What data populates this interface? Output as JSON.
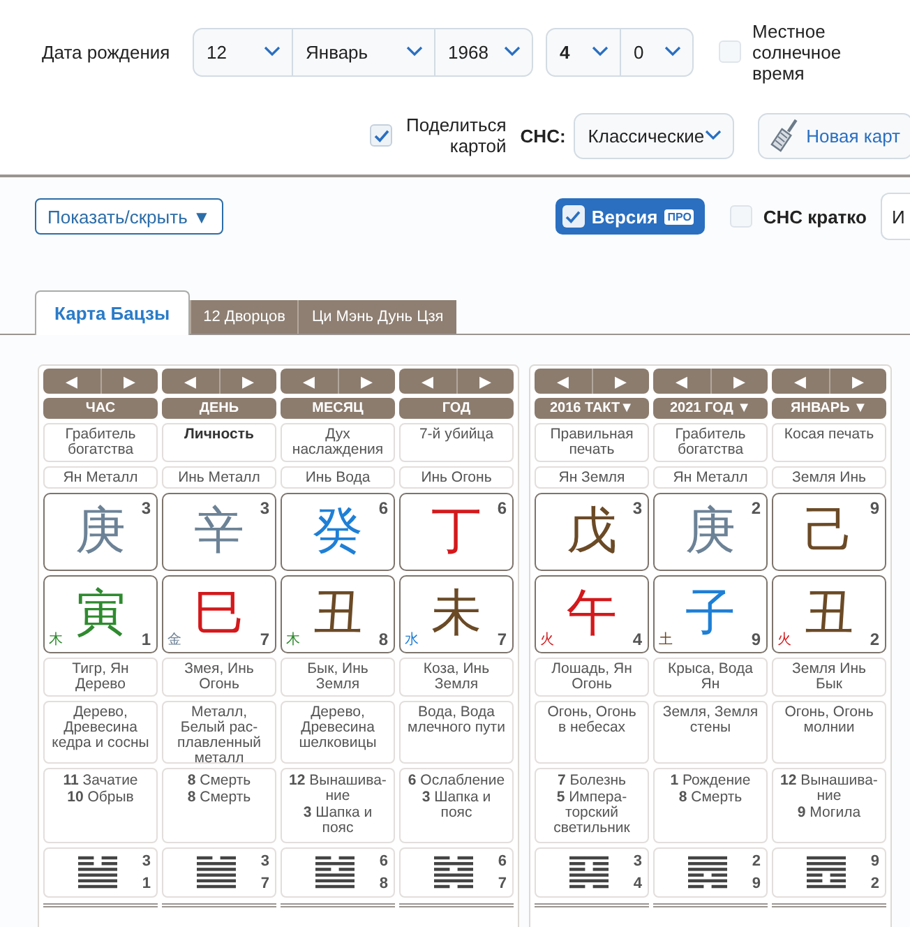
{
  "birth_date": {
    "label": "Дата рождения",
    "day": "12",
    "month": "Январь",
    "year": "1968",
    "hour": "4",
    "minute": "0"
  },
  "local_solar_time": {
    "label": "Местное солнечное время",
    "checked": false
  },
  "share_chart": {
    "label": "Поделиться картой",
    "checked": true
  },
  "sns": {
    "label": "СНС:",
    "value": "Классические"
  },
  "new_chart_button": "Новая карт",
  "show_hide_button": "Показать/скрыть ▼",
  "pro_version": {
    "label": "Версия",
    "badge": "ПРО",
    "checked": true
  },
  "sns_short": {
    "label": "СНС кратко",
    "checked": false
  },
  "cut_select": "И",
  "tabs": [
    {
      "label": "Карта Бацзы",
      "selected": true
    },
    {
      "label": "12 Дворцов",
      "selected": false
    },
    {
      "label": "Ци Мэнь Дунь Цзя",
      "selected": false
    }
  ],
  "charts": [
    {
      "pillars": [
        {
          "nav": [
            "◀",
            "▶"
          ],
          "header": "ЧАС",
          "ten_god": "Грабитель богатства",
          "self": false,
          "stem_element": "Ян Металл",
          "stem": {
            "char": "庚",
            "color": "#6c8296",
            "number": "3"
          },
          "branch": {
            "char": "寅",
            "color": "#2f8a2f",
            "number": "1",
            "element": {
              "char": "木",
              "color": "#2f8a2f"
            }
          },
          "animal": "Тигр, Ян Дерево",
          "nayin": "Дерево, Древесина кедра и сосны",
          "stages": [
            "**11** Зачатие",
            "**10** Обрыв"
          ],
          "hexagram": {
            "solid": [
              false,
              false,
              true,
              true,
              true,
              true
            ],
            "upper": "3",
            "lower": "1"
          }
        },
        {
          "nav": [
            "◀",
            "▶"
          ],
          "header": "ДЕНЬ",
          "ten_god": "Личность",
          "self": true,
          "stem_element": "Инь Металл",
          "stem": {
            "char": "辛",
            "color": "#6c8296",
            "number": "3"
          },
          "branch": {
            "char": "巳",
            "color": "#d3191c",
            "number": "7",
            "element": {
              "char": "金",
              "color": "#6c8296"
            }
          },
          "animal": "Змея, Инь Огонь",
          "nayin": "Металл, Белый рас-плавленный металл",
          "stages": [
            "**8** Смерть",
            "**8** Смерть"
          ],
          "hexagram": {
            "solid": [
              false,
              true,
              true,
              true,
              true,
              true
            ],
            "upper": "3",
            "lower": "7"
          }
        },
        {
          "nav": [
            "◀",
            "▶"
          ],
          "header": "МЕСЯЦ",
          "ten_god": "Дух наслаждения",
          "self": false,
          "stem_element": "Инь Вода",
          "stem": {
            "char": "癸",
            "color": "#1e7fd6",
            "number": "6"
          },
          "branch": {
            "char": "丑",
            "color": "#6b4a26",
            "number": "8",
            "element": {
              "char": "木",
              "color": "#2f8a2f"
            }
          },
          "animal": "Бык, Инь Земля",
          "nayin": "Дерево, Древесина шелковицы",
          "stages": [
            "**12** Вынашива-ние",
            "**3** Шапка и пояс"
          ],
          "hexagram": {
            "solid": [
              false,
              true,
              false,
              true,
              true,
              true
            ],
            "upper": "6",
            "lower": "8"
          }
        },
        {
          "nav": [
            "◀",
            "▶"
          ],
          "header": "ГОД",
          "ten_god": "7-й убийца",
          "self": false,
          "stem_element": "Инь Огонь",
          "stem": {
            "char": "丁",
            "color": "#d3191c",
            "number": "6"
          },
          "branch": {
            "char": "未",
            "color": "#6b4a26",
            "number": "7",
            "element": {
              "char": "水",
              "color": "#1e7fd6"
            }
          },
          "animal": "Коза, Инь Земля",
          "nayin": "Вода, Вода млечного пути",
          "stages": [
            "**6** Ослабление",
            "**3** Шапка и пояс"
          ],
          "hexagram": {
            "solid": [
              false,
              true,
              false,
              true,
              true,
              false
            ],
            "upper": "6",
            "lower": "7"
          }
        }
      ]
    },
    {
      "pillars": [
        {
          "nav": [
            "◀",
            "▶"
          ],
          "header": "2016 ТАКТ▼",
          "ten_god": "Правильная печать",
          "self": false,
          "stem_element": "Ян Земля",
          "stem": {
            "char": "戊",
            "color": "#6b4a26",
            "number": "3"
          },
          "branch": {
            "char": "午",
            "color": "#d3191c",
            "number": "4",
            "element": {
              "char": "火",
              "color": "#d3191c"
            }
          },
          "animal": "Лошадь, Ян Огонь",
          "nayin": "Огонь, Огонь в небесах",
          "stages": [
            "**7** Болезнь",
            "**5** Импера-торский светильник"
          ],
          "hexagram": {
            "solid": [
              true,
              false,
              false,
              true,
              true,
              false
            ],
            "upper": "3",
            "lower": "4"
          }
        },
        {
          "nav": [
            "◀",
            "▶"
          ],
          "header": "2021 ГОД ▼",
          "ten_god": "Грабитель богатства",
          "self": false,
          "stem_element": "Ян Металл",
          "stem": {
            "char": "庚",
            "color": "#6c8296",
            "number": "2"
          },
          "branch": {
            "char": "子",
            "color": "#1e7fd6",
            "number": "9",
            "element": {
              "char": "土",
              "color": "#6b4a26"
            }
          },
          "animal": "Крыса, Вода Ян",
          "nayin": "Земля, Земля стены",
          "stages": [
            "**1** Рождение",
            "**8** Смерть"
          ],
          "hexagram": {
            "solid": [
              true,
              true,
              true,
              false,
              true,
              false
            ],
            "upper": "2",
            "lower": "9"
          }
        },
        {
          "nav": [
            "◀",
            "▶"
          ],
          "header": "ЯНВАРЬ ▼",
          "ten_god": "Косая печать",
          "self": false,
          "stem_element": "Земля Инь",
          "stem": {
            "char": "己",
            "color": "#6b4a26",
            "number": "9"
          },
          "branch": {
            "char": "丑",
            "color": "#6b4a26",
            "number": "2",
            "element": {
              "char": "火",
              "color": "#d3191c"
            }
          },
          "animal": "Земля Инь Бык",
          "nayin": "Огонь, Огонь молнии",
          "stages": [
            "**12** Вынашива-ние",
            "**9** Могила"
          ],
          "hexagram": {
            "solid": [
              true,
              true,
              true,
              false,
              false,
              true
            ],
            "upper": "9",
            "lower": "2"
          }
        }
      ]
    }
  ]
}
